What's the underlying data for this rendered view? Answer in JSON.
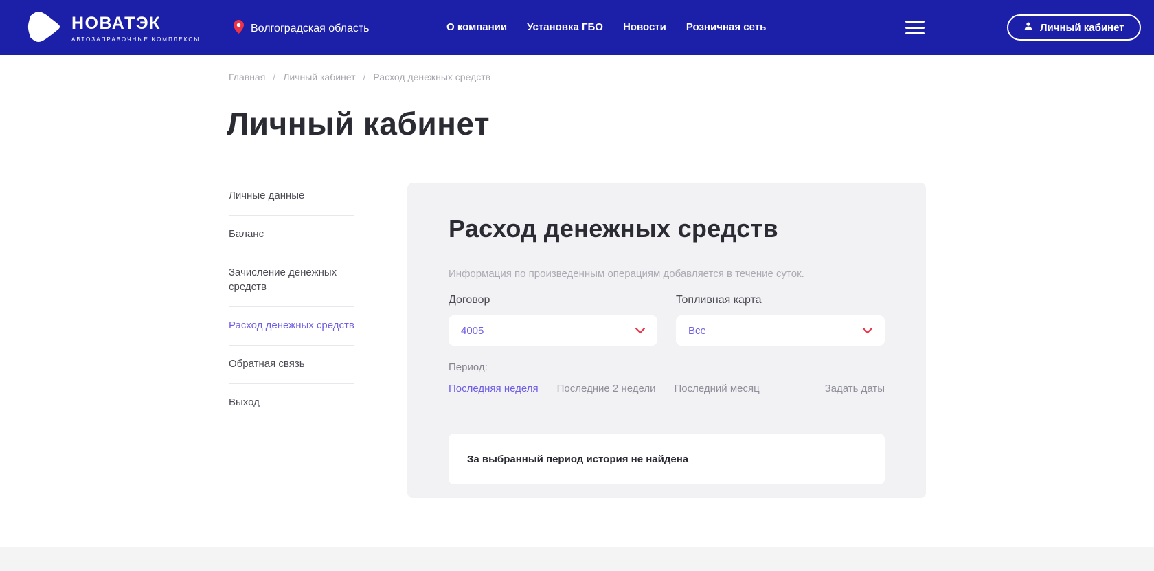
{
  "header": {
    "logo": {
      "title": "НОВАТЭК",
      "subtitle": "АВТОЗАПРАВОЧНЫЕ КОМПЛЕКСЫ"
    },
    "region": {
      "label": "Волгоградская область"
    },
    "nav": [
      {
        "label": "О компании"
      },
      {
        "label": "Установка ГБО"
      },
      {
        "label": "Новости"
      },
      {
        "label": "Розничная сеть"
      }
    ],
    "account_button": "Личный кабинет"
  },
  "breadcrumb": {
    "separator": "/",
    "items": [
      {
        "label": "Главная"
      },
      {
        "label": "Личный кабинет"
      },
      {
        "label": "Расход денежных средств"
      }
    ]
  },
  "page": {
    "title": "Личный кабинет"
  },
  "sidebar": {
    "items": [
      {
        "label": "Личные данные",
        "active": false
      },
      {
        "label": "Баланс",
        "active": false
      },
      {
        "label": "Зачисление денежных средств",
        "active": false
      },
      {
        "label": "Расход денежных средств",
        "active": true
      },
      {
        "label": "Обратная связь",
        "active": false
      },
      {
        "label": "Выход",
        "active": false
      }
    ]
  },
  "panel": {
    "title": "Расход денежных средств",
    "note": "Информация по произведенным операциям добавляется в течение суток.",
    "contract": {
      "label": "Договор",
      "value": "4005"
    },
    "fuel_card": {
      "label": "Топливная карта",
      "value": "Все"
    },
    "period": {
      "label": "Период:",
      "options": [
        {
          "label": "Последняя неделя",
          "active": true
        },
        {
          "label": "Последние 2 недели",
          "active": false
        },
        {
          "label": "Последний месяц",
          "active": false
        },
        {
          "label": "Задать даты",
          "active": false
        }
      ]
    },
    "empty_message": "За выбранный период история не найдена"
  },
  "colors": {
    "header_bg": "#1c1fa8",
    "accent_red": "#ec3347",
    "link_purple": "#6f5fe6",
    "text_dark": "#2b2b33",
    "panel_bg": "#f2f2f4",
    "footer_bg": "#f4f4f5"
  }
}
